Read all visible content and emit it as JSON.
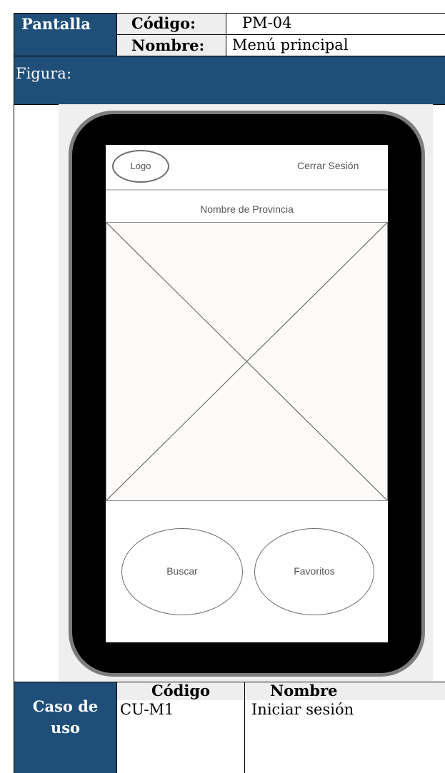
{
  "header": {
    "pantalla_label": "Pantalla",
    "codigo_label": "Código:",
    "codigo_value": "PM-04",
    "nombre_label": "Nombre:",
    "nombre_value": "Menú principal"
  },
  "figura": {
    "label": "Figura:"
  },
  "mockup": {
    "logo": "Logo",
    "logout": "Cerrar Sesión",
    "province": "Nombre de Provincia",
    "buttons": {
      "search": "Buscar",
      "favorites": "Favoritos"
    }
  },
  "use_case": {
    "label_line1": "Caso de",
    "label_line2": "uso",
    "col_code": "Código",
    "col_name": "Nombre",
    "rows": [
      {
        "code": "CU-M1",
        "name": "Iniciar sesión"
      }
    ]
  },
  "colors": {
    "header_bg": "#1f4e79",
    "grey_bg": "#eeeeee"
  }
}
